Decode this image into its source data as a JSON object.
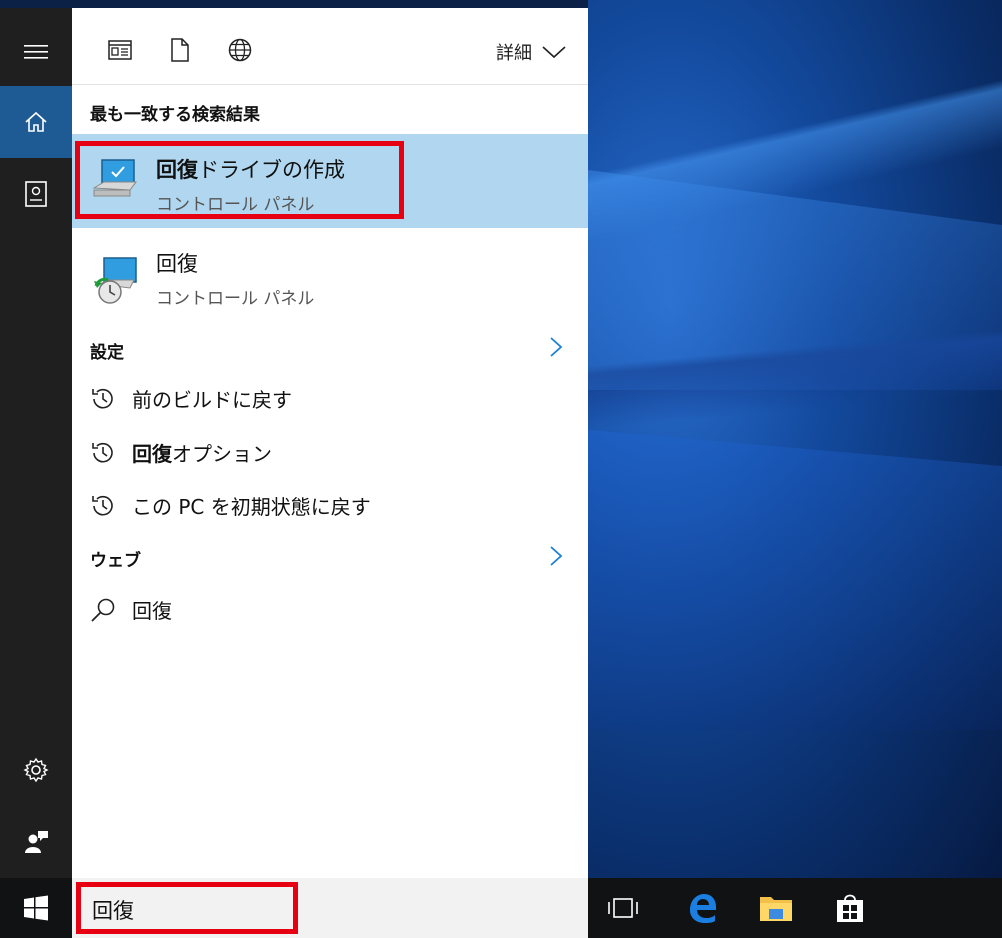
{
  "top_tabs": {
    "apps_icon": "apps-tab-icon",
    "docs_icon": "documents-tab-icon",
    "web_icon": "web-tab-icon",
    "details_label": "詳細"
  },
  "best_match": {
    "heading": "最も一致する検索結果",
    "title_bold": "回復",
    "title_rest": "ドライブの作成",
    "subtitle": "コントロール パネル"
  },
  "second_result": {
    "title": "回復",
    "subtitle": "コントロール パネル"
  },
  "settings": {
    "heading": "設定",
    "items": [
      {
        "pre": "",
        "bold": "",
        "text": "前のビルドに戻す"
      },
      {
        "pre": "",
        "bold": "回復",
        "text": "オプション"
      },
      {
        "pre": "",
        "bold": "",
        "text": "この PC を初期状態に戻す"
      }
    ]
  },
  "web": {
    "heading": "ウェブ",
    "items": [
      {
        "text": "回復"
      }
    ]
  },
  "search": {
    "value": "回復"
  },
  "colors": {
    "highlight": "#b1d7f0",
    "accent_rail": "#1e5a94",
    "outline_red": "#e60012",
    "chevron_blue": "#1e7fd6"
  }
}
